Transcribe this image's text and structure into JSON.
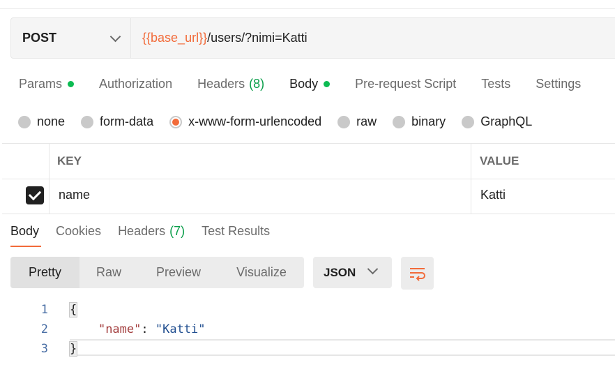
{
  "request": {
    "method": "POST",
    "url_var": "{{base_url}}",
    "url_path": "/users/?nimi=Katti"
  },
  "request_tabs": [
    {
      "label": "Params",
      "dot": true
    },
    {
      "label": "Authorization"
    },
    {
      "label": "Headers",
      "count": "(8)"
    },
    {
      "label": "Body",
      "dot": true,
      "active": true
    },
    {
      "label": "Pre-request Script"
    },
    {
      "label": "Tests"
    },
    {
      "label": "Settings"
    }
  ],
  "body_types": [
    "none",
    "form-data",
    "x-www-form-urlencoded",
    "raw",
    "binary",
    "GraphQL"
  ],
  "body_type_selected": "x-www-form-urlencoded",
  "kv_table": {
    "headers": {
      "key": "KEY",
      "value": "VALUE"
    },
    "rows": [
      {
        "checked": true,
        "key": "name",
        "value": "Katti"
      }
    ]
  },
  "response_tabs": [
    {
      "label": "Body",
      "active": true
    },
    {
      "label": "Cookies"
    },
    {
      "label": "Headers",
      "count": "(7)"
    },
    {
      "label": "Test Results"
    }
  ],
  "format_buttons": [
    "Pretty",
    "Raw",
    "Preview",
    "Visualize"
  ],
  "format_selected": "Pretty",
  "language": "JSON",
  "code_lines": [
    {
      "n": "1",
      "open": "{"
    },
    {
      "n": "2",
      "key": "\"name\"",
      "sep": ": ",
      "val": "\"Katti\""
    },
    {
      "n": "3",
      "close": "}"
    }
  ],
  "colors": {
    "accent": "#f26b3a",
    "green": "#0cbb52"
  }
}
